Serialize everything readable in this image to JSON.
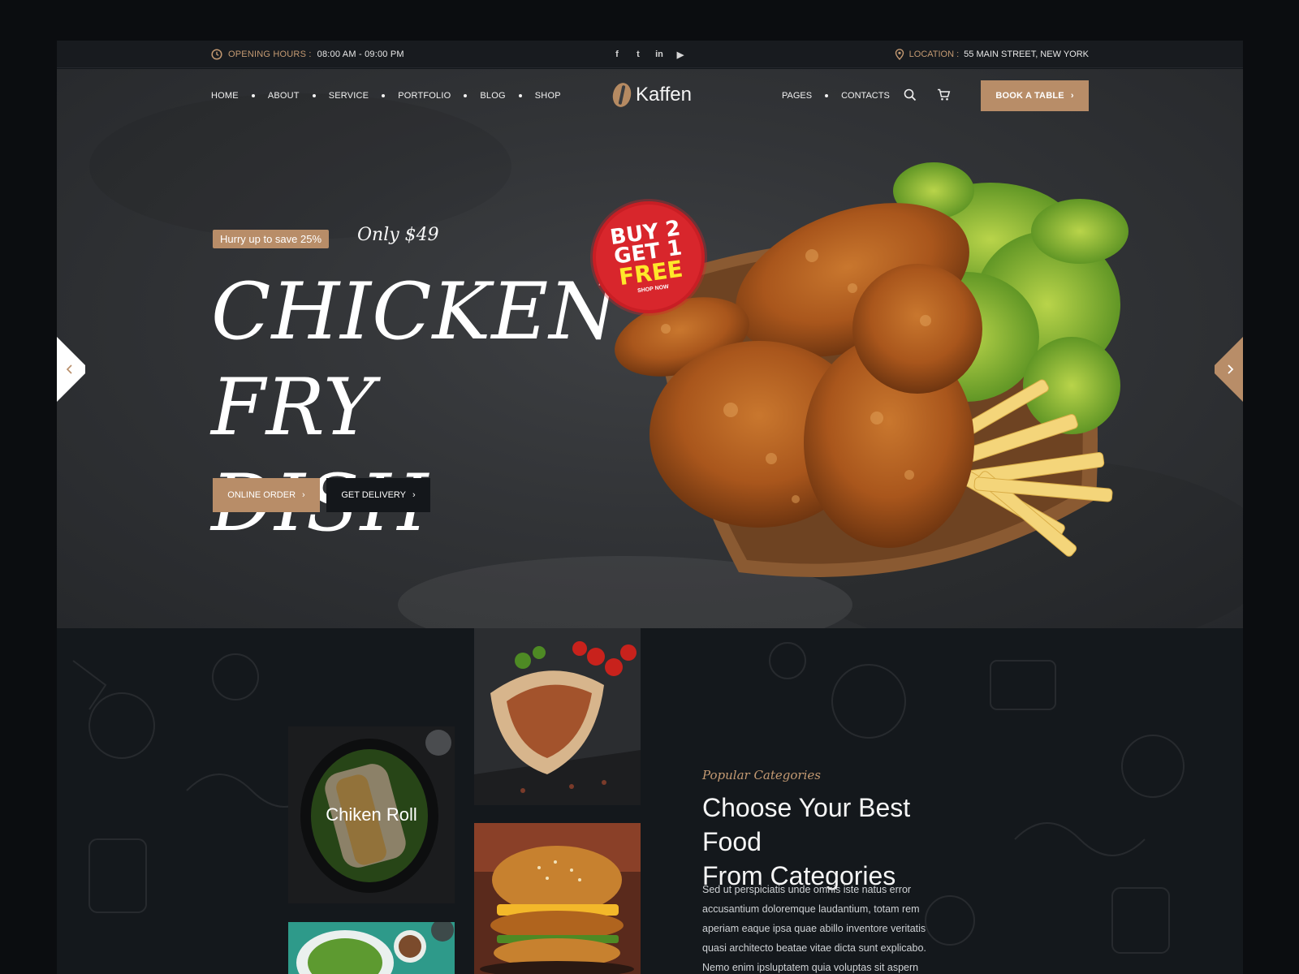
{
  "topbar": {
    "hours_label": "OPENING  HOURS :",
    "hours_value": "08:00 AM - 09:00 PM",
    "socials": [
      "f",
      "t",
      "in",
      "▶"
    ],
    "location_label": "LOCATION :",
    "location_value": "55 MAIN STREET, NEW YORK"
  },
  "nav": {
    "left_items": [
      "HOME",
      "ABOUT",
      "SERVICE",
      "PORTFOLIO",
      "BLOG",
      "SHOP"
    ],
    "right_items": [
      "PAGES",
      "CONTACTS"
    ],
    "brand": "Kaffen",
    "book_label": "BOOK A TABLE"
  },
  "hero": {
    "tag": "Hurry up to save 25%",
    "price": "Only $49",
    "headline_line1": "CHICKEN",
    "headline_line2": "FRY DISH",
    "order_label": "ONLINE ORDER",
    "delivery_label": "GET DELIVERY",
    "badge_line1": "BUY 2",
    "badge_line2": "GET 1",
    "badge_line3": "FREE",
    "badge_line4": "SHOP NOW"
  },
  "categories": {
    "eyebrow": "Popular Categories",
    "title_line1": "Choose Your Best Food",
    "title_line2": "From Categories",
    "body": "Sed ut perspiciatis unde omnis iste natus error accusantium doloremque laudantium, totam rem aperiam eaque ipsa quae abillo inventore veritatis quasi architecto beatae vitae dicta sunt explicabo. Nemo enim ipsluptatem quia voluptas sit aspern",
    "cards": [
      {
        "label": "Chiken Roll"
      }
    ]
  },
  "colors": {
    "accent": "#b88d68",
    "page_bg": "#13171b",
    "hero_bg": "#333538"
  }
}
